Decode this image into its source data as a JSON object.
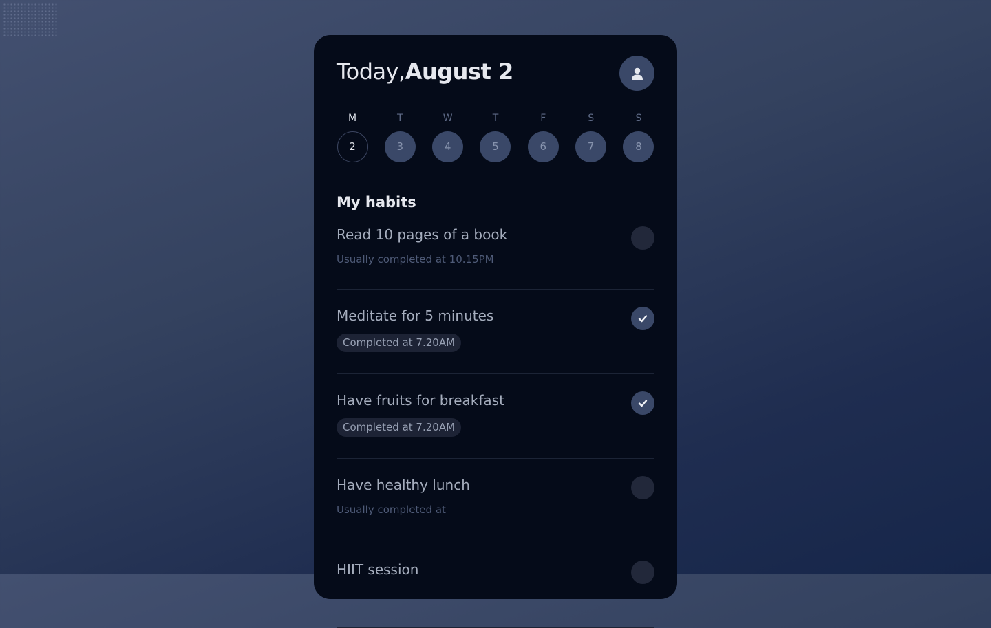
{
  "header": {
    "title_prefix": "Today,",
    "title_date": "August 2",
    "avatar_icon": "user-icon"
  },
  "week": [
    {
      "letter": "M",
      "day": "2",
      "active": true
    },
    {
      "letter": "T",
      "day": "3",
      "active": false
    },
    {
      "letter": "W",
      "day": "4",
      "active": false
    },
    {
      "letter": "T",
      "day": "5",
      "active": false
    },
    {
      "letter": "F",
      "day": "6",
      "active": false
    },
    {
      "letter": "S",
      "day": "7",
      "active": false
    },
    {
      "letter": "S",
      "day": "8",
      "active": false
    }
  ],
  "habits_section": {
    "title": "My habits",
    "items": [
      {
        "name": "Read 10 pages of a book",
        "status": "Usually completed at 10.15PM",
        "completed": false
      },
      {
        "name": "Meditate for 5 minutes",
        "status": "Completed at 7.20AM",
        "completed": true
      },
      {
        "name": "Have fruits for breakfast",
        "status": "Completed at 7.20AM",
        "completed": true
      },
      {
        "name": "Have healthy lunch",
        "status": "Usually completed at",
        "completed": false
      },
      {
        "name": "HIIT session",
        "status": "",
        "completed": false
      }
    ]
  },
  "colors": {
    "card_bg": "#050b19",
    "accent": "#3a4868",
    "text_primary": "#e6e8ee",
    "text_secondary": "#a5adbd"
  }
}
